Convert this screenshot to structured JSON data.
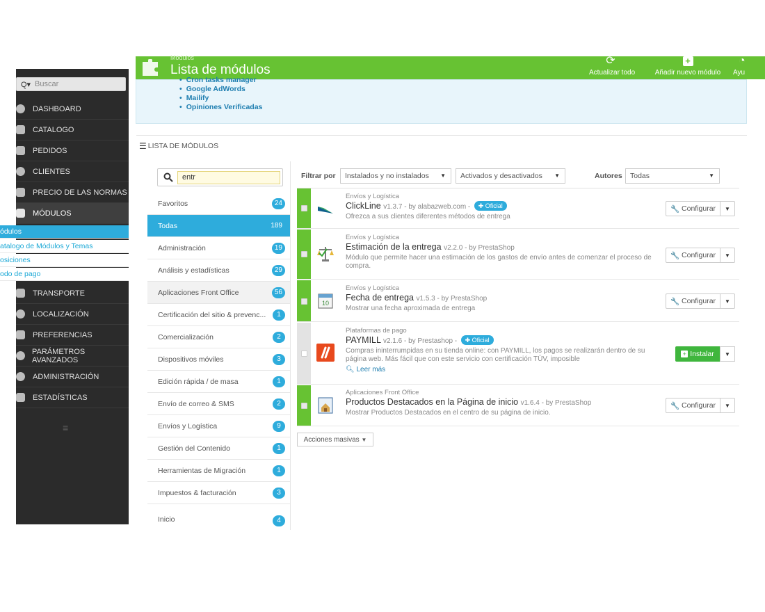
{
  "header": {
    "small_title": "Módulos",
    "title": "Lista de módulos",
    "actions": [
      {
        "label": "Actualizar todo",
        "icon": "refresh-icon"
      },
      {
        "label": "Añadir nuevo módulo",
        "icon": "add-icon"
      },
      {
        "label": "Ayu",
        "icon": "help-icon"
      }
    ]
  },
  "sidebar": {
    "search_prefix": "Q▾",
    "search_placeholder": "Buscar",
    "items": [
      {
        "label": "DASHBOARD",
        "icon": "dashboard-icon"
      },
      {
        "label": "CATALOGO",
        "icon": "catalog-icon"
      },
      {
        "label": "PEDIDOS",
        "icon": "orders-icon"
      },
      {
        "label": "CLIENTES",
        "icon": "customers-icon"
      },
      {
        "label": "PRECIO DE LAS NORMAS",
        "icon": "price-rules-icon"
      },
      {
        "label": "MÓDULOS",
        "icon": "puzzle-icon"
      },
      {
        "label": "TRANSPORTE",
        "icon": "truck-icon"
      },
      {
        "label": "LOCALIZACIÓN",
        "icon": "globe-icon"
      },
      {
        "label": "PREFERENCIAS",
        "icon": "wrench-icon"
      },
      {
        "label": "PARÁMETROS AVANZADOS",
        "icon": "gears-icon"
      },
      {
        "label": "ADMINISTRACIÓN",
        "icon": "cog-icon"
      },
      {
        "label": "ESTADÍSTICAS",
        "icon": "bar-chart-icon"
      }
    ],
    "subitems": [
      {
        "label": "ódulos"
      },
      {
        "label": "atalogo de Módulos y Temas"
      },
      {
        "label": "osiciones"
      },
      {
        "label": "odo de pago"
      }
    ]
  },
  "info_box": {
    "items": [
      "Cron tasks manager",
      "Google AdWords",
      "Mailify",
      "Opiniones Verificadas"
    ]
  },
  "panel": {
    "heading": "LISTA DE MÓDULOS"
  },
  "category_search": {
    "value": "entr"
  },
  "categories": [
    {
      "label": "Favoritos",
      "count": "24"
    },
    {
      "label": "Todas",
      "count": "189"
    },
    {
      "label": "Administración",
      "count": "19"
    },
    {
      "label": "Análisis y estadísticas",
      "count": "29"
    },
    {
      "label": "Aplicaciones Front Office",
      "count": "56"
    },
    {
      "label": "Certificación del sitio & prevenc...",
      "count": "1"
    },
    {
      "label": "Comercialización",
      "count": "2"
    },
    {
      "label": "Dispositivos móviles",
      "count": "3"
    },
    {
      "label": "Edición rápida / de masa",
      "count": "1"
    },
    {
      "label": "Envío de correo & SMS",
      "count": "2"
    },
    {
      "label": "Envíos y Logística",
      "count": "9"
    },
    {
      "label": "Gestión del Contenido",
      "count": "1"
    },
    {
      "label": "Herramientas de Migración",
      "count": "1"
    },
    {
      "label": "Impuestos & facturación",
      "count": "3"
    },
    {
      "label": "Inicio",
      "count": "4"
    }
  ],
  "filters": {
    "label": "Filtrar por",
    "install": "Instalados y no instalados",
    "status": "Activados y desactivados",
    "authors_label": "Autores",
    "authors": "Todas"
  },
  "modules": [
    {
      "category": "Envíos y Logística",
      "name": "ClickLine",
      "version": "v1.3.7 - by alabazweb.com -",
      "badge": "Oficial",
      "desc": "Ofrezca a sus clientes diferentes métodos de entrega",
      "action": "Configurar"
    },
    {
      "category": "Envíos y Logística",
      "name": "Estimación de la entrega",
      "version": "v2.2.0 - by PrestaShop",
      "badge": "",
      "desc": "Módulo que permite hacer una estimación de los gastos de envío antes de comenzar el proceso de compra.",
      "action": "Configurar"
    },
    {
      "category": "Envíos y Logística",
      "name": "Fecha de entrega",
      "version": "v1.5.3 - by PrestaShop",
      "badge": "",
      "desc": "Mostrar una fecha aproximada de entrega",
      "action": "Configurar"
    },
    {
      "category": "Plataformas de pago",
      "name": "PAYMILL",
      "version": "v2.1.6 - by Prestashop -",
      "badge": "Oficial",
      "desc": "Compras ininterrumpidas en su tienda online: con PAYMILL, los pagos se realizarán dentro de su página web. Más fácil que con este servicio con certificación TÜV, imposible",
      "more": "Leer más",
      "action": "Instalar"
    },
    {
      "category": "Aplicaciones Front Office",
      "name": "Productos Destacados en la Página de inicio",
      "version": "v1.6.4 - by PrestaShop",
      "badge": "",
      "desc": "Mostrar Productos Destacados en el centro de su página de inicio.",
      "action": "Configurar"
    }
  ],
  "bulk": {
    "label": "Acciones masivas"
  },
  "colors": {
    "header_green": "#67c233",
    "accent_blue": "#2eacdc",
    "sidebar_dark": "#2b2b2b",
    "install_green": "#3fb63d"
  }
}
